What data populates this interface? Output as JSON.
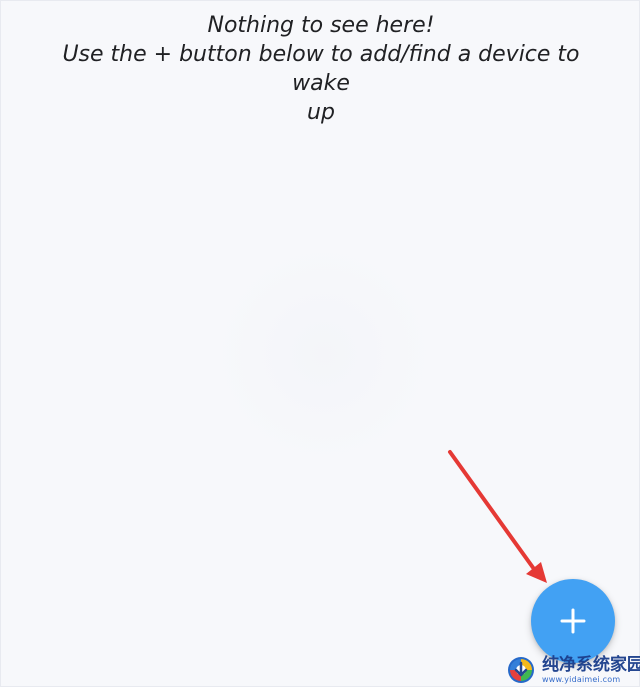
{
  "empty_state": {
    "line_1": "Nothing to see here!",
    "line_2": "Use the + button below to add/find a device to wake",
    "line_3": "up"
  },
  "fab": {
    "icon": "plus-icon",
    "color": "#42a1f3"
  },
  "annotation": {
    "arrow_color": "#e53935"
  },
  "watermark": {
    "title": "纯净系统家园",
    "url": "www.yidaimei.com"
  }
}
